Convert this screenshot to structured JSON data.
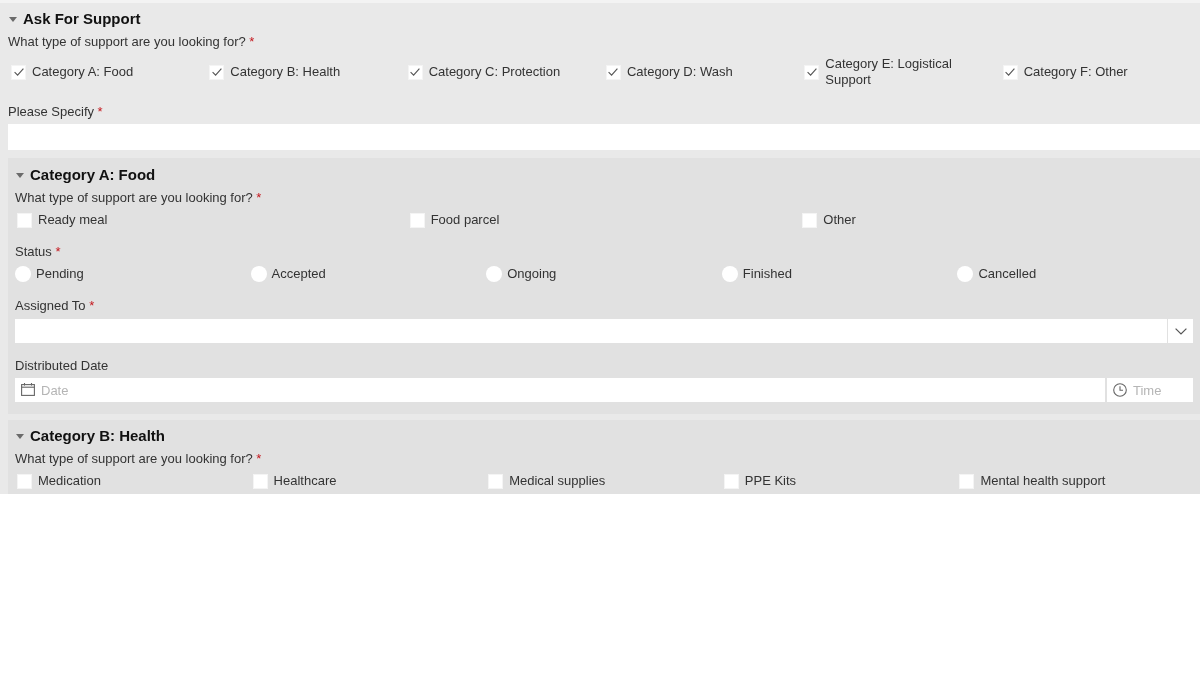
{
  "form": {
    "title": "Ask For Support",
    "expanded": true,
    "fields": [
      {
        "kind": "checkboxes",
        "label": "What type of support are you looking for?",
        "required_mark": "*",
        "options": [
          {
            "label": "Category A: Food",
            "checked": true
          },
          {
            "label": "Category B: Health",
            "checked": true
          },
          {
            "label": "Category C: Protection",
            "checked": true
          },
          {
            "label": "Category D: Wash",
            "checked": true
          },
          {
            "label": "Category E: Logistical Support",
            "checked": true
          },
          {
            "label": "Category F: Other",
            "checked": true
          }
        ]
      },
      {
        "kind": "text",
        "label": "Please Specify",
        "required_mark": "*"
      }
    ],
    "subsections": [
      {
        "title": "Category A: Food",
        "expanded": true,
        "fields": [
          {
            "kind": "checkboxes",
            "label": "What type of support are you looking for?",
            "required_mark": "*",
            "options": [
              {
                "label": "Ready meal",
                "checked": false
              },
              {
                "label": "Food parcel",
                "checked": false
              },
              {
                "label": "Other",
                "checked": false
              }
            ]
          },
          {
            "kind": "radios",
            "label": "Status",
            "required_mark": "*",
            "options": [
              {
                "label": "Pending",
                "selected": false
              },
              {
                "label": "Accepted",
                "selected": false
              },
              {
                "label": "Ongoing",
                "selected": false
              },
              {
                "label": "Finished",
                "selected": false
              },
              {
                "label": "Cancelled",
                "selected": false
              }
            ]
          },
          {
            "kind": "select",
            "label": "Assigned To",
            "required_mark": "*"
          },
          {
            "kind": "datetime",
            "label": "Distributed Date",
            "date_placeholder": "Date",
            "time_placeholder": "Time"
          }
        ]
      },
      {
        "title": "Category B: Health",
        "expanded": true,
        "fields": [
          {
            "kind": "checkboxes",
            "label": "What type of support are you looking for?",
            "required_mark": "*",
            "options": [
              {
                "label": "Medication",
                "checked": false
              },
              {
                "label": "Healthcare",
                "checked": false
              },
              {
                "label": "Medical supplies",
                "checked": false
              },
              {
                "label": "PPE Kits",
                "checked": false
              },
              {
                "label": "Mental health support",
                "checked": false
              }
            ]
          }
        ]
      }
    ]
  }
}
